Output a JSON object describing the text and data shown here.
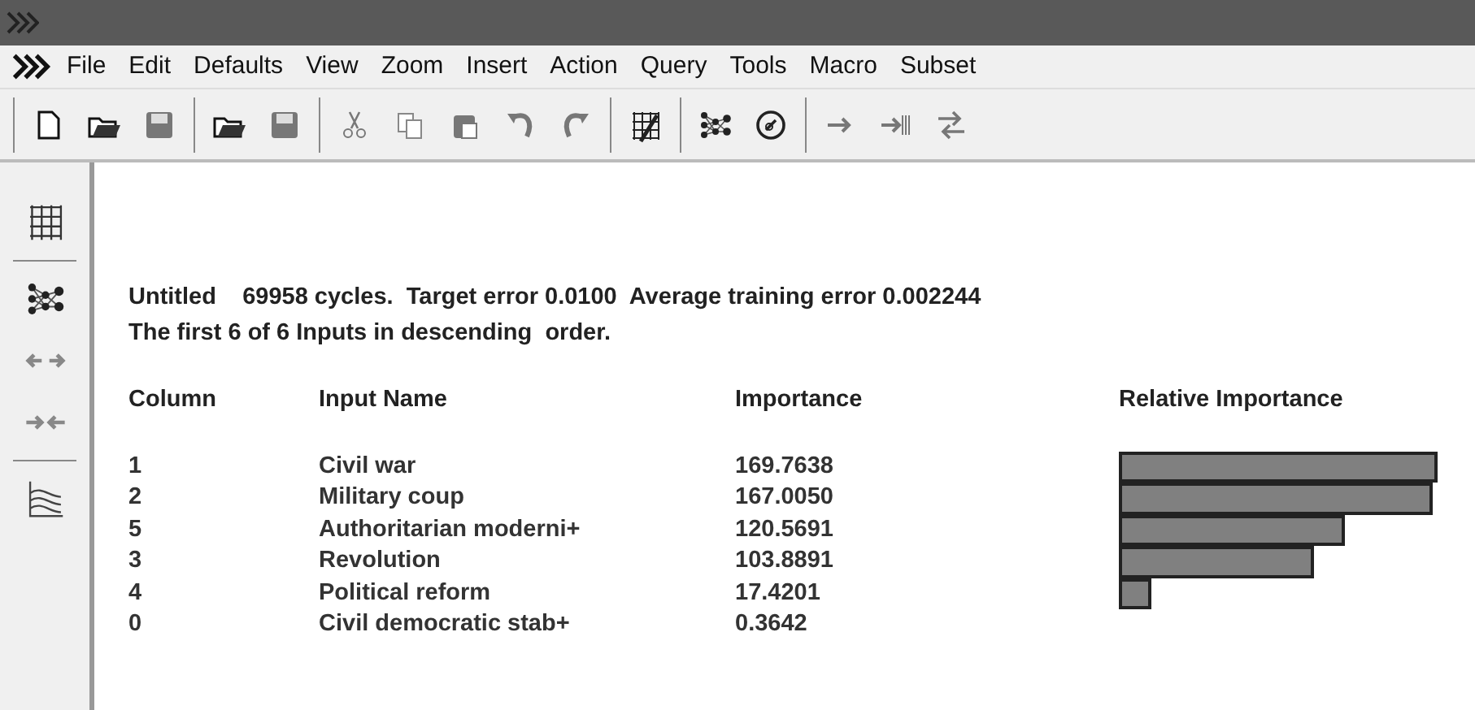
{
  "menu": [
    "File",
    "Edit",
    "Defaults",
    "View",
    "Zoom",
    "Insert",
    "Action",
    "Query",
    "Tools",
    "Macro",
    "Subset"
  ],
  "report": {
    "summary": "Untitled    69958 cycles.  Target error 0.0100  Average training error 0.002244",
    "subtitle": "The first 6 of 6 Inputs in descending  order.",
    "columns": [
      "Column",
      "Input Name",
      "Importance",
      "Relative Importance"
    ],
    "rows": [
      {
        "column": "1",
        "name": "Civil war",
        "importance": "169.7638"
      },
      {
        "column": "2",
        "name": "Military coup",
        "importance": "167.0050"
      },
      {
        "column": "5",
        "name": "Authoritarian moderni+",
        "importance": "120.5691"
      },
      {
        "column": "3",
        "name": "Revolution",
        "importance": "103.8891"
      },
      {
        "column": "4",
        "name": "Political reform",
        "importance": "17.4201"
      },
      {
        "column": "0",
        "name": "Civil democratic stab+",
        "importance": "0.3642"
      }
    ]
  }
}
